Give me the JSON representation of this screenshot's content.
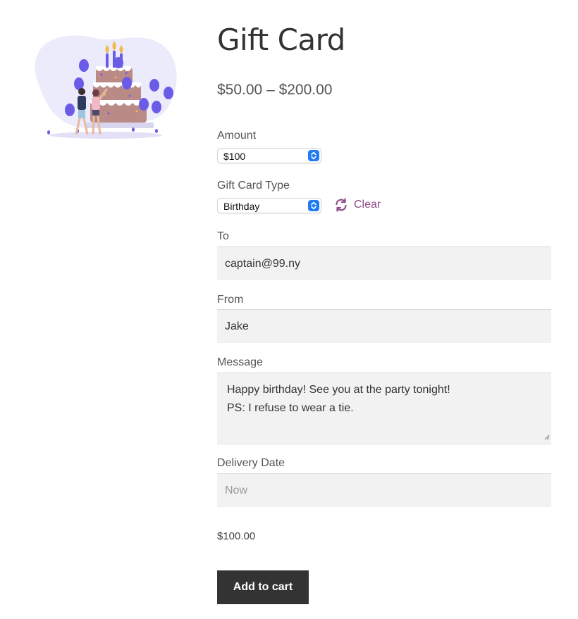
{
  "product": {
    "title": "Gift Card",
    "price_range": "$50.00 – $200.00",
    "image_icon": "birthday-cake-illustration"
  },
  "amount": {
    "label": "Amount",
    "selected": "$100"
  },
  "gift_card_type": {
    "label": "Gift Card Type",
    "selected": "Birthday",
    "clear_label": "Clear",
    "clear_icon": "refresh-icon"
  },
  "to": {
    "label": "To",
    "value": "captain@99.ny"
  },
  "from": {
    "label": "From",
    "value": "Jake"
  },
  "message": {
    "label": "Message",
    "lines": [
      "Happy birthday! See you at the party tonight!",
      "PS: I refuse to wear a tie."
    ]
  },
  "delivery_date": {
    "label": "Delivery Date",
    "placeholder": "Now"
  },
  "variation_price": "$100.00",
  "add_to_cart_label": "Add to cart",
  "colors": {
    "accent_link": "#8f4b8a",
    "button_bg": "#333333",
    "field_bg": "#f2f2f2",
    "select_arrow": "#1f7cf5",
    "balloon": "#6b5ce7"
  }
}
